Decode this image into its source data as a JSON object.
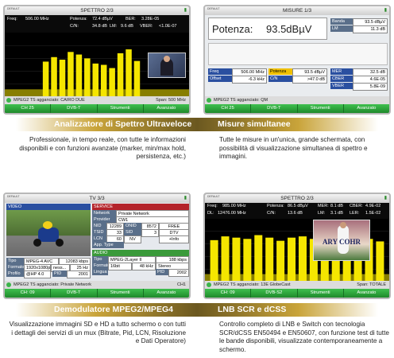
{
  "panel1": {
    "title": "SPETTRO 2/3",
    "default": "DEFAULT",
    "freq_label": "Freq:",
    "freq_value": "506.00 MHz",
    "power_label": "Potenza:",
    "power_value": "72.4 dBµV",
    "cn_label": "C/N:",
    "cn_value": "34.8 dB",
    "ber_label": "BER:",
    "ber_value": "3.28E-05",
    "lm_label": "LM:",
    "lm_value": "9.6 dB",
    "vber_label": "VBER:",
    "vber_value": "<1.0E-07",
    "status_text": "MPEG2 TS agganciato: CAIRO DUE",
    "span_label": "Span:",
    "span_value": "500 MHz",
    "softkeys": [
      "CH 25",
      "DVB-T",
      "Strumenti",
      "Avanzato"
    ],
    "bar_heights": [
      0.55,
      0.62,
      0.58,
      0.7,
      0.66,
      0.6,
      0.52,
      0.5,
      0.45,
      0.68,
      0.74,
      0.56
    ]
  },
  "panel2": {
    "title": "MISURE 1/3",
    "default": "DEFAULT",
    "big_label": "Potenza:",
    "big_value": "93.5dBµV",
    "banda_label": "Banda",
    "banda_value": "93.5 dBµV",
    "lm_label": "LM",
    "lm_value": "11.3 dB",
    "freq_label": "Freq",
    "freq_value": "506.00 MHz",
    "potenza_label": "Potenza",
    "potenza_value": "93.5 dBµV",
    "mer_label": "MER",
    "mer_value": "32.5 dB",
    "offset_label": "Offset",
    "offset_value": "-6.3 kHz",
    "cn_label": "C/N",
    "cn_value": ">47.0 dB",
    "cber_label": "CBER",
    "cber_value": "4.6E-05",
    "vber_label": "VBER",
    "vber_value": "5.8E-09",
    "status_text": "MPEG2 TS agganciato: QM",
    "softkeys": [
      "CH 25",
      "DVB-T",
      "Strumenti",
      "Avanzato"
    ]
  },
  "panel3": {
    "title": "TV 3/3",
    "default": "DEFAULT",
    "video_label": "VIDEO",
    "service_label": "SERVICE",
    "audio_label": "AUDIO",
    "network_label": "Network",
    "network_value": "Private Network",
    "provider_label": "Provider",
    "provider_value": "CW1",
    "nid_label": "NID",
    "nid_value": "12289",
    "onid_label": "ONID",
    "onid_value": "8572",
    "free_value": "FREE",
    "tsid_label": "TSID",
    "tsid_value": "33",
    "sid_label": "SID",
    "sid_value": "3",
    "dtv_value": "DTV",
    "lcn_label": "LCN",
    "lcn_value": "60",
    "nvs_value": "NV",
    "info_value": "+Info",
    "apptype_label": "App. Type",
    "tipo_label": "Tipo",
    "tipo_value": "MPEG-4 AVC",
    "rate_value": "12083 kbps",
    "formato_label": "Formato",
    "formato_value": "1920x1080p",
    "ness_value": "ness...",
    "fps_value": "25 Hz",
    "profilo_label": "Profilo",
    "profilo_value": "@HP 4.0",
    "pid_label": "PID",
    "pid_value": "2001",
    "atipo_label": "Tipo",
    "atipo_value": "MPEG-2Layer II",
    "arate_value": "188 kbps",
    "aformato_label": "Formato",
    "aformato_value": "16bit",
    "ahz_value": "48 kHz",
    "stereo_value": "Stereo",
    "lingua_label": "Lingua",
    "apid_label": "PID",
    "apid_value": "2002",
    "status_text": "MPEG2 TS agganciato: Private Network",
    "status_right": "CH1",
    "softkeys": [
      "CH: 09",
      "DVB-T",
      "Strumenti",
      "Avanzato"
    ]
  },
  "panel4": {
    "title": "SPETTRO 2/3",
    "default": "DEFAULT",
    "freq_label": "Freq:",
    "freq_value": "985.00 MHz",
    "power_label": "Potenza:",
    "power_value": "86.5 dBµV",
    "mer_label": "MER:",
    "mer_value": "8.1 dB",
    "cber_label": "CBER:",
    "cber_value": "4.9E-02",
    "dl_label": "DL:",
    "dl_value": "12476.00 MHz",
    "cn_label": "C/N:",
    "cn_value": "13.6 dB",
    "lm_label": "LM:",
    "lm_value": "3.1 dB",
    "ler_label": "LER:",
    "ler_value": "1.5E-02",
    "status_text": "MPEG2 TS agganciato: 13E GlobeCast",
    "span_label": "Span:",
    "span_value": "TOTALE",
    "softkeys": [
      "CH: 09",
      "DVB-S2",
      "Strumenti",
      "Avanzato"
    ],
    "bar_heights": [
      0.66,
      0.72,
      0.7,
      0.68,
      0.74,
      0.7,
      0.65,
      0.7,
      0.72,
      0.68,
      0.7,
      0.66,
      0.62,
      0.7,
      0.68,
      0.64
    ],
    "tv_text": "ARY COHR"
  },
  "captions": {
    "c1": "Analizzatore di Spettro Ultraveloce",
    "c2": "Misure simultanee",
    "c3": "Demodulatore MPEG2/MPEG4",
    "c4": "LNB SCR e dCSS"
  },
  "descriptions": {
    "d1": "Professionale, in tempo reale, con tutte le informazioni disponibili e con funzioni avanzate (marker, min/max hold, persistenza, etc.)",
    "d2": "Tutte le misure in un'unica, grande schermata, con possibilità di visualizzazione simultanea di spettro e immagini.",
    "d3": "Visualizzazione immagini SD e HD a tutto schermo o con tutti i dettagli dei servizi di un mux (Bitrate, Pid, LCN, Risoluzione e Dati Operatore)",
    "d4": "Controllo completo di LNB e Switch con tecnologia SCR/dCSS EN50494 e EN50607, con funzione test di tutte le bande disponibili, visualizzate contemporaneamente a schermo."
  },
  "colors": {
    "accent_gold": "#c9a43a",
    "softkey_green": "#2aa33a",
    "spectrum_yellow": "#f5e600"
  }
}
